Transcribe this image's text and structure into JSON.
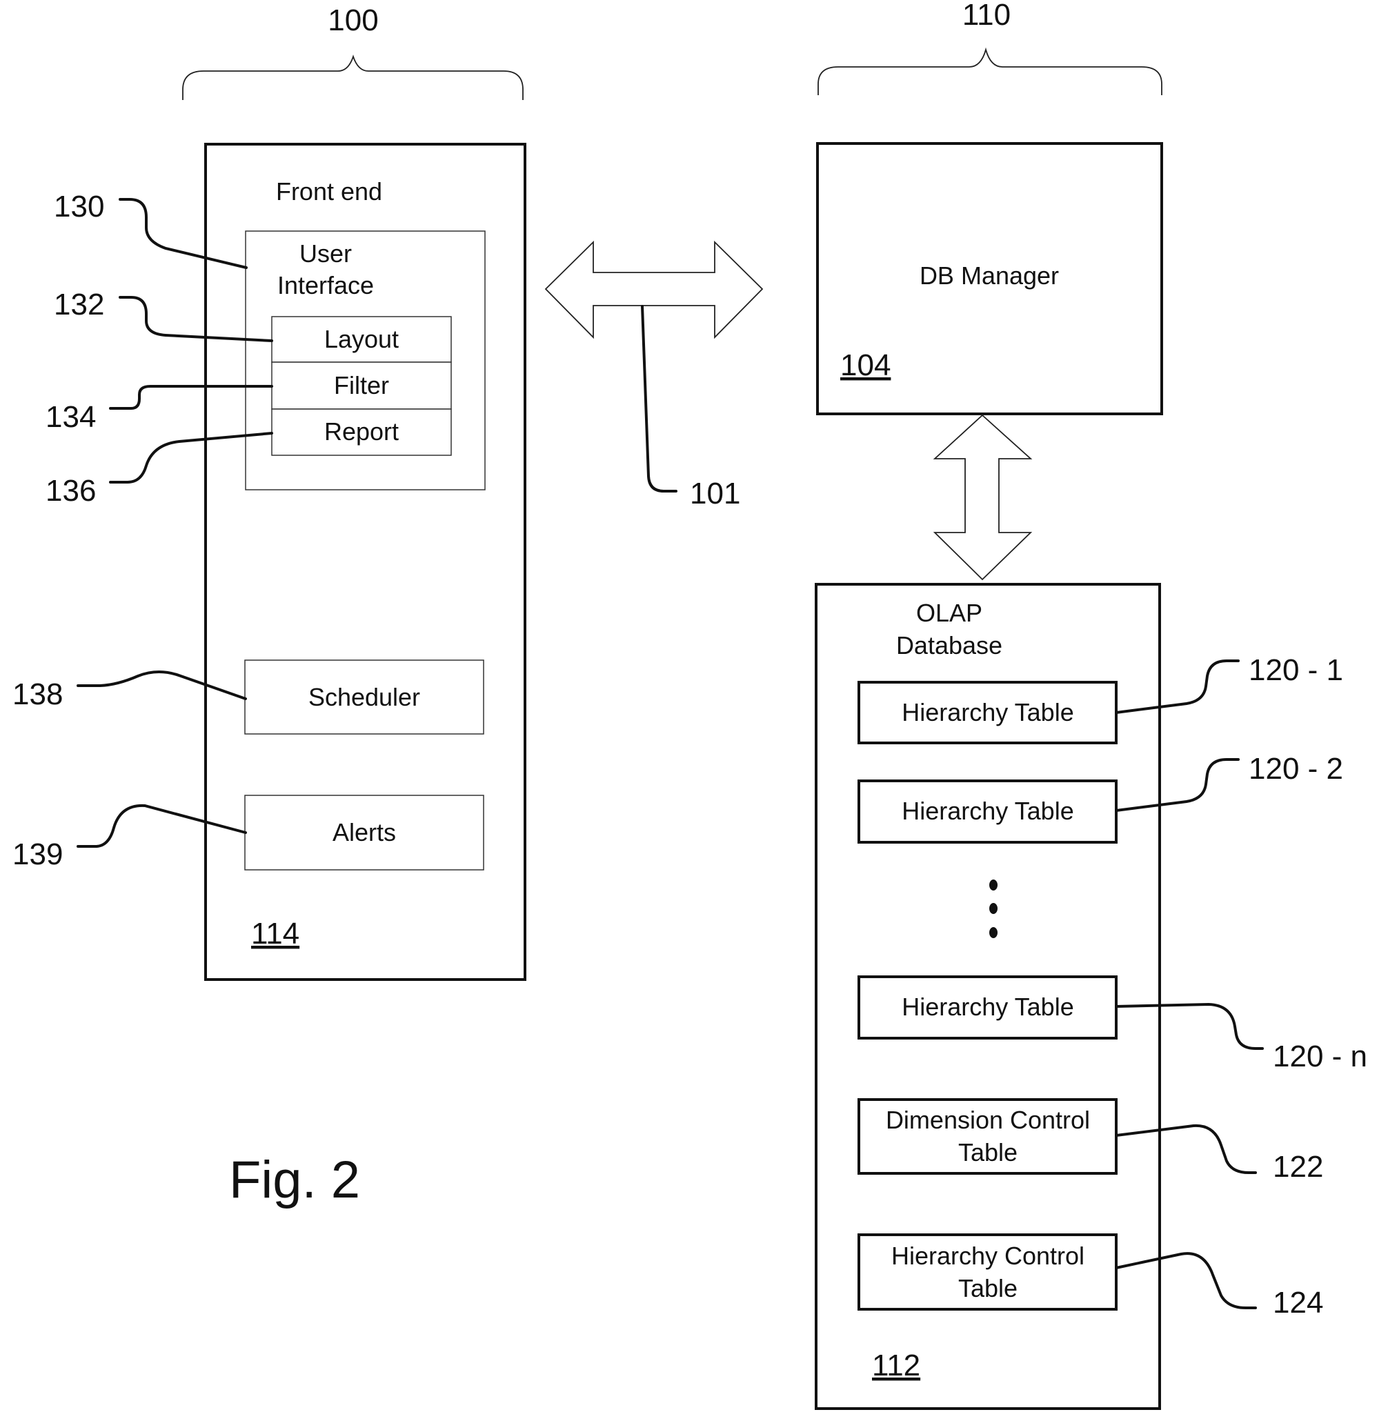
{
  "figure": {
    "caption": "Fig. 2",
    "system_groups": [
      {
        "ref": "100"
      },
      {
        "ref": "110"
      }
    ],
    "front_end": {
      "title": "Front end",
      "ref": "114",
      "user_interface": {
        "title_line1": "User",
        "title_line2": "Interface",
        "ref": "130",
        "components": [
          {
            "label": "Layout",
            "ref": "132"
          },
          {
            "label": "Filter",
            "ref": "134"
          },
          {
            "label": "Report",
            "ref": "136"
          }
        ]
      },
      "scheduler": {
        "label": "Scheduler",
        "ref": "138"
      },
      "alerts": {
        "label": "Alerts",
        "ref": "139"
      }
    },
    "connection": {
      "ref": "101"
    },
    "db_manager": {
      "title": "DB Manager",
      "ref": "104"
    },
    "olap_database": {
      "title_line1": "OLAP",
      "title_line2": "Database",
      "ref": "112",
      "hierarchy_tables": [
        {
          "label": "Hierarchy Table",
          "ref": "120 - 1"
        },
        {
          "label": "Hierarchy Table",
          "ref": "120 - 2"
        },
        {
          "label": "Hierarchy Table",
          "ref": "120 - n"
        }
      ],
      "dimension_control": {
        "line1": "Dimension Control",
        "line2": "Table",
        "ref": "122"
      },
      "hierarchy_control": {
        "line1": "Hierarchy Control",
        "line2": "Table",
        "ref": "124"
      }
    }
  }
}
